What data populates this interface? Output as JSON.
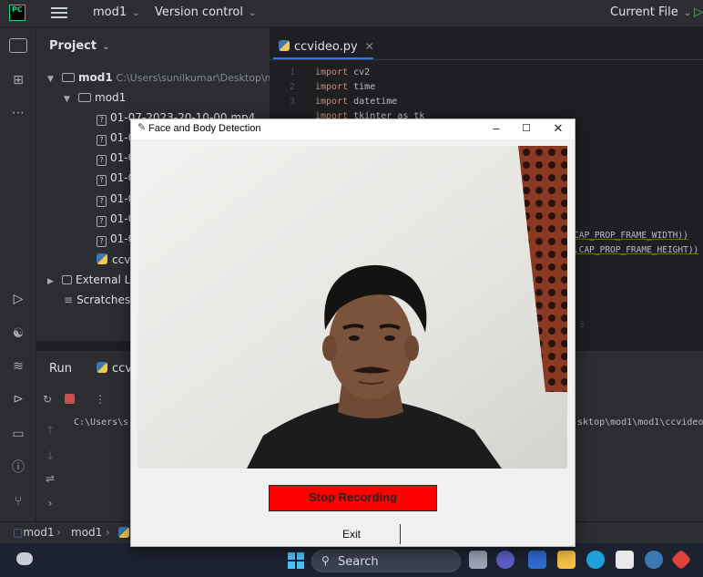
{
  "ide": {
    "logo_text": "PC",
    "project_menu": "mod1",
    "vcs_menu": "Version control",
    "current_file_menu": "Current File"
  },
  "project_panel": {
    "title": "Project",
    "root": {
      "name": "mod1",
      "path": "C:\\Users\\sunilkumar\\Desktop\\mo"
    },
    "folder": "mod1",
    "files": [
      "01-07-2023-20-10-00.mp4",
      "01-0",
      "01-0",
      "01-0",
      "01-0",
      "01-0",
      "01-0"
    ],
    "script": "ccvi",
    "external_libraries": "External Li",
    "scratches": "Scratches"
  },
  "editor": {
    "tab_label": "ccvideo.py",
    "lines": [
      {
        "no": "1",
        "kw": "import",
        "rest": " cv2"
      },
      {
        "no": "2",
        "kw": "import",
        "rest": " time"
      },
      {
        "no": "3",
        "kw": "import",
        "rest": " datetime"
      },
      {
        "no": "",
        "kw": "import",
        "rest": " tkinter as tk"
      }
    ],
    "frag_width": "CAP_PROP_FRAME_WIDTH))",
    "frag_height": ".CAP_PROP_FRAME_HEIGHT))",
    "scroll_marker": "3"
  },
  "run_panel": {
    "label": "Run",
    "tab": "ccvi",
    "console_left": "C:\\Users\\s",
    "console_right": "sktop\\mod1\\mod1\\ccvideo."
  },
  "breadcrumb": [
    "mod1",
    "mod1"
  ],
  "dialog": {
    "title": "Face and Body Detection",
    "minimize": "–",
    "maximize": "☐",
    "close": "✕",
    "stop_label": "Stop Recording",
    "exit_label": "Exit"
  },
  "taskbar": {
    "search_placeholder": "Search"
  },
  "colors": {
    "ide_bg": "#1e1f22",
    "panel_bg": "#2b2d30",
    "keyword": "#cf8e6d",
    "stop_button": "#ff0000",
    "accent": "#3574f0"
  }
}
